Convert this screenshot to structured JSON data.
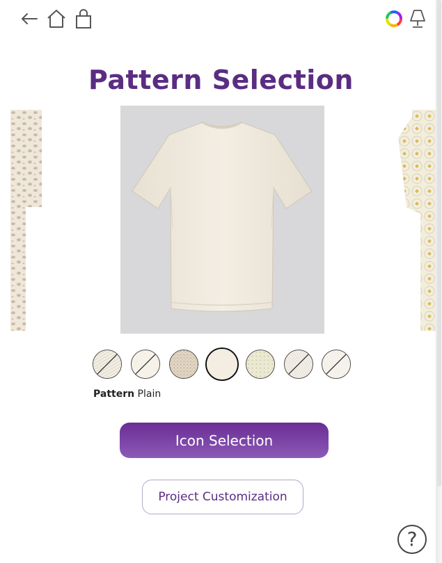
{
  "header": {
    "icons": [
      "back-arrow-icon",
      "home-icon",
      "shopping-bag-icon",
      "color-wheel-icon",
      "lamp-icon"
    ],
    "title": "Pattern Selection"
  },
  "preview": {
    "garment": "t-shirt",
    "garment_color": "#f1ebdf",
    "background_color": "#d8d8da"
  },
  "swatches": {
    "items": [
      {
        "name": "diagonal-lines",
        "selected": false
      },
      {
        "name": "plain-light",
        "selected": false
      },
      {
        "name": "speckled",
        "selected": false
      },
      {
        "name": "plain",
        "selected": true
      },
      {
        "name": "dotted",
        "selected": false
      },
      {
        "name": "fine-lines",
        "selected": false
      },
      {
        "name": "diagonal-stroke",
        "selected": false
      }
    ]
  },
  "pattern_info": {
    "label": "Pattern",
    "value": "Plain"
  },
  "buttons": {
    "primary_label": "Icon Selection",
    "secondary_label": "Project Customization",
    "help_label": "?"
  },
  "colors": {
    "brand_purple": "#5a2d82",
    "button_gradient_top": "#6a2d94",
    "button_gradient_bottom": "#8c5ab8"
  }
}
